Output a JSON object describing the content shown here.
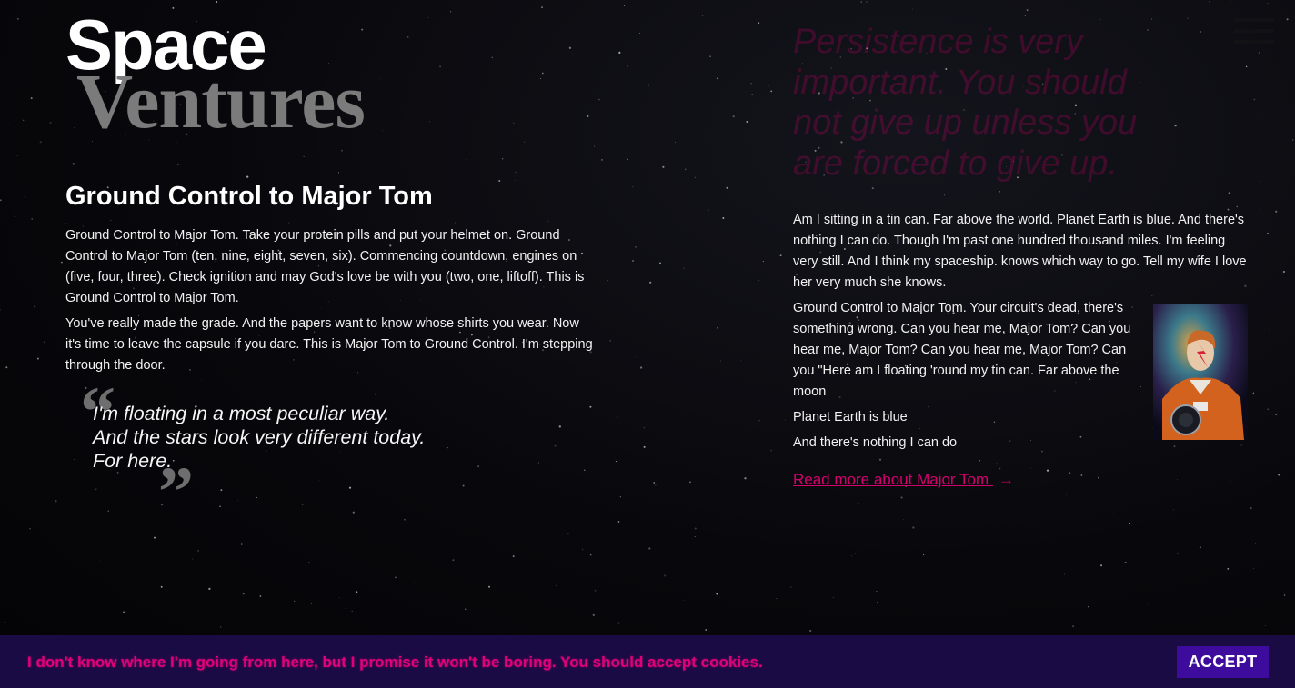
{
  "logo": {
    "line1": "Space",
    "line2": "Ventures"
  },
  "article": {
    "title": "Ground Control to Major Tom",
    "paragraphs": [
      "Ground Control to Major Tom. Take your protein pills and put your helmet on. Ground Control to Major Tom (ten, nine, eight, seven, six). Commencing countdown, engines on (five, four, three). Check ignition and may God's love be with you (two, one, liftoff). This is Ground Control to Major Tom.",
      "You've really made the grade. And the papers want to know whose shirts you wear. Now it's time to leave the capsule if you dare. This is Major Tom to Ground Control. I'm stepping through the door."
    ],
    "quote": {
      "lines": [
        "I'm floating in a most peculiar way.",
        "And the stars look very different today.",
        "For here."
      ]
    }
  },
  "tagline": "Persistence is very important. You should not give up unless you are forced to give up.",
  "sidebar": {
    "paragraphs": [
      "Am I sitting in a tin can. Far above the world. Planet Earth is blue. And there's nothing I can do. Though I'm past one hundred thousand miles. I'm feeling very still. And I think my spaceship. knows which way to go. Tell my wife I love her very much she knows.",
      "Ground Control to Major Tom. Your circuit's dead, there's something wrong. Can you hear me, Major Tom? Can you hear me, Major Tom? Can you hear me, Major Tom? Can you \"Here am I floating 'round my tin can. Far above the moon",
      "Planet Earth is blue",
      "And there's nothing I can do"
    ],
    "read_more": "Read more about Major Tom",
    "read_more_arrow": "→"
  },
  "cookie": {
    "message": "I don't know where I'm going from here, but I promise it won't be boring. You should accept cookies.",
    "accept_label": "ACCEPT"
  },
  "colors": {
    "accent": "#d4006e",
    "cookie_bg": "#1b0b45",
    "accept_bg": "#3d0c9c",
    "logo_secondary": "#7b7b7b"
  },
  "icons": [
    "menu-icon",
    "arrow-right-icon",
    "quote-open-icon",
    "quote-close-icon"
  ]
}
